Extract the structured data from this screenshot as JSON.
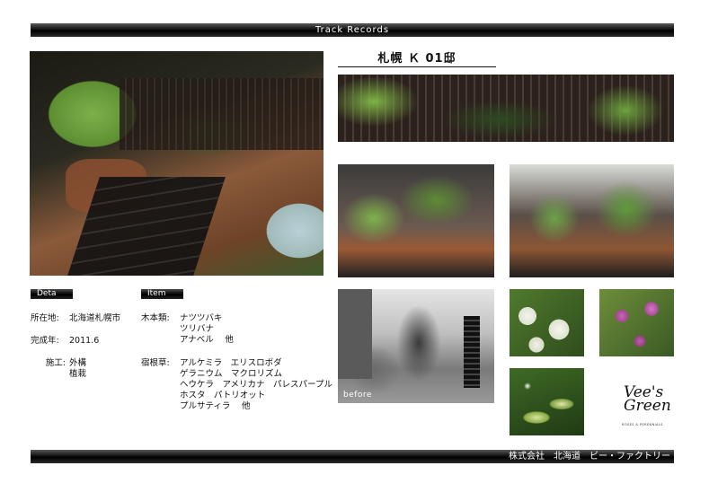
{
  "header": {
    "title": "Track Records"
  },
  "project": {
    "title": "札幌 Ｋ 01邸"
  },
  "photos": {
    "before_label": "before"
  },
  "deta": {
    "section_label": "Deta",
    "location_label": "所在地:",
    "location_value": "北海道札幌市",
    "completion_label": "完成年:",
    "completion_value": "2011.6",
    "construction_label": "施工:",
    "construction_values": [
      "外構",
      "植栽"
    ]
  },
  "item": {
    "section_label": "Item",
    "trees_label": "木本類:",
    "trees": [
      "ナツツバキ",
      "ツリバナ",
      "アナベル　 他"
    ],
    "perennials_label": "宿根草:",
    "perennials": [
      "アルケミラ　エリスロポダ",
      "ゲラニウム　マクロリズム",
      "ヘウケラ　アメリカナ　パレスパープル",
      "ホスタ　パトリオット",
      "プルサティラ　 他"
    ]
  },
  "logo": {
    "script_line1": "Vee's",
    "script_line2": "Green",
    "tagline": "ROSES & PERENNIALS"
  },
  "footer": {
    "company": "株式会社　北海道　ビー・ファクトリー"
  }
}
